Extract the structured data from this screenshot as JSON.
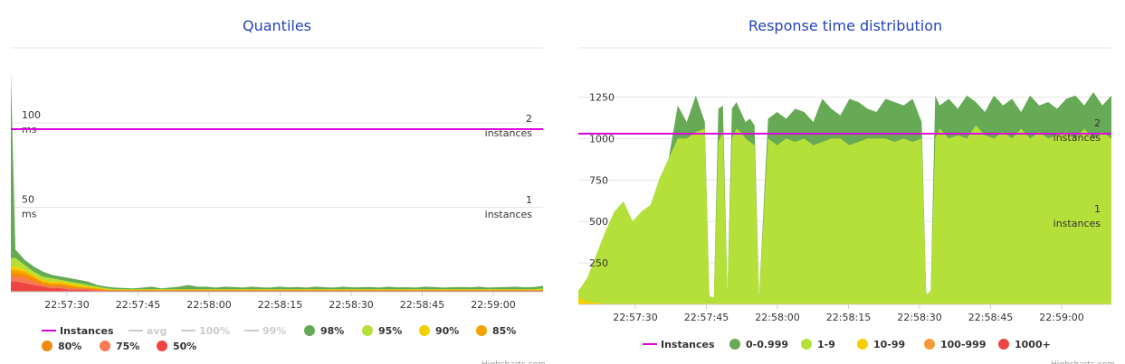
{
  "chart_data": [
    {
      "type": "area",
      "title": "Quantiles",
      "y_left": {
        "ticks": [
          {
            "value": 100,
            "unit": "ms"
          },
          {
            "value": 50,
            "unit": "ms"
          }
        ]
      },
      "y_right": {
        "ticks": [
          {
            "value": 2,
            "unit": "instances"
          },
          {
            "value": 1,
            "unit": "instances"
          }
        ]
      },
      "x_ticks": [
        "22:57:30",
        "22:57:45",
        "22:58:00",
        "22:58:15",
        "22:58:30",
        "22:58:45",
        "22:59:00"
      ],
      "legend": [
        {
          "name": "Instances",
          "color": "#dd00dd",
          "symbol": "line",
          "enabled": true
        },
        {
          "name": "avg",
          "color": "#cccccc",
          "symbol": "line",
          "enabled": false
        },
        {
          "name": "100%",
          "color": "#cccccc",
          "symbol": "line",
          "enabled": false
        },
        {
          "name": "99%",
          "color": "#cccccc",
          "symbol": "line",
          "enabled": false
        },
        {
          "name": "98%",
          "color": "#66aa55",
          "symbol": "dot",
          "enabled": true
        },
        {
          "name": "95%",
          "color": "#b5e03a",
          "symbol": "dot",
          "enabled": true
        },
        {
          "name": "90%",
          "color": "#f5d000",
          "symbol": "dot",
          "enabled": true
        },
        {
          "name": "85%",
          "color": "#f5a300",
          "symbol": "dot",
          "enabled": true
        },
        {
          "name": "80%",
          "color": "#f08a10",
          "symbol": "dot",
          "enabled": true
        },
        {
          "name": "75%",
          "color": "#f87a55",
          "symbol": "dot",
          "enabled": true
        },
        {
          "name": "50%",
          "color": "#ee4444",
          "symbol": "dot",
          "enabled": true
        }
      ],
      "instances_line": 2,
      "series": [
        {
          "name": "50%",
          "color": "#ee4444",
          "x": [
            0,
            1,
            3,
            5,
            7,
            9,
            11,
            13,
            15,
            17,
            19,
            21,
            23,
            25,
            27,
            29,
            31,
            33,
            35,
            37,
            39,
            41,
            43,
            45,
            47,
            49,
            51,
            53,
            55,
            57,
            59,
            61,
            63,
            65,
            67,
            69,
            71,
            73,
            75,
            77,
            79,
            81,
            83,
            85,
            87,
            89,
            91,
            93,
            95,
            97,
            99,
            101,
            103,
            105,
            107,
            109,
            111,
            113,
            115,
            117
          ],
          "y": [
            6,
            6,
            5,
            4,
            3,
            2,
            2,
            1,
            1,
            1,
            0.5,
            0.5,
            0.5,
            0.5,
            0.5,
            0.5,
            0.5,
            0.5,
            0.5,
            0.5,
            0.5,
            0.5,
            0.5,
            0.5,
            0.5,
            0.5,
            0.5,
            0.5,
            0.5,
            0.5,
            0.5,
            0.5,
            0.5,
            0.5,
            0.5,
            0.5,
            0.5,
            0.5,
            0.5,
            0.5,
            0.5,
            0.5,
            0.5,
            0.5,
            0.5,
            0.5,
            0.5,
            0.5,
            0.5,
            0.5,
            0.5,
            0.5,
            0.5,
            0.5,
            0.5,
            0.5,
            0.5,
            0.5,
            0.5,
            0.5
          ]
        },
        {
          "name": "75%",
          "color": "#f87a55",
          "y": [
            9,
            9,
            8,
            6,
            4,
            3,
            3,
            2,
            2,
            1.5,
            1,
            0.8,
            0.6,
            0.6,
            0.6,
            0.6,
            0.6,
            0.6,
            0.6,
            0.6,
            0.6,
            0.6,
            0.6,
            0.6,
            0.6,
            0.6,
            0.6,
            0.6,
            0.6,
            0.6,
            0.6,
            0.6,
            0.6,
            0.6,
            0.6,
            0.6,
            0.6,
            0.6,
            0.6,
            0.6,
            0.6,
            0.6,
            0.6,
            0.6,
            0.6,
            0.6,
            0.6,
            0.6,
            0.6,
            0.6,
            0.6,
            0.6,
            0.6,
            0.6,
            0.6,
            0.6,
            0.6,
            0.6,
            0.6,
            0.6
          ]
        },
        {
          "name": "80%",
          "color": "#f08a10",
          "y": [
            11,
            11,
            10,
            8,
            5,
            4,
            4,
            3,
            2,
            2,
            1.5,
            1,
            0.8,
            0.8,
            0.8,
            0.8,
            0.8,
            0.8,
            0.8,
            0.8,
            0.8,
            0.8,
            0.8,
            0.8,
            0.8,
            0.8,
            0.8,
            0.8,
            0.8,
            0.8,
            0.8,
            0.8,
            0.8,
            0.8,
            0.8,
            0.8,
            0.8,
            0.8,
            0.8,
            0.8,
            0.8,
            0.8,
            0.8,
            0.8,
            0.8,
            0.8,
            0.8,
            0.8,
            0.8,
            0.8,
            0.8,
            0.8,
            0.8,
            0.8,
            0.8,
            0.8,
            0.8,
            0.8,
            0.8,
            0.8
          ]
        },
        {
          "name": "85%",
          "color": "#f5a300",
          "y": [
            13,
            13,
            12,
            9,
            6,
            5,
            5,
            4,
            3,
            2.5,
            2,
            1.2,
            1,
            1,
            1,
            1,
            1,
            1,
            1,
            1,
            1,
            1,
            1,
            1,
            1,
            1,
            1,
            1,
            1,
            1,
            1,
            1,
            1,
            1,
            1,
            1,
            1,
            1,
            1,
            1,
            1,
            1,
            1,
            1,
            1,
            1,
            1,
            1,
            1,
            1,
            1,
            1,
            1,
            1,
            1,
            1,
            1,
            1,
            1,
            1
          ]
        },
        {
          "name": "90%",
          "color": "#f5d000",
          "y": [
            15,
            15,
            13,
            10,
            7,
            6,
            6,
            5,
            4,
            3,
            2.5,
            1.5,
            1.2,
            1.2,
            1.2,
            1.2,
            1.2,
            1.2,
            1.2,
            1.2,
            1.2,
            1.2,
            1.2,
            1.2,
            1.2,
            1.2,
            1.2,
            1.2,
            1.2,
            1.2,
            1.2,
            1.2,
            1.2,
            1.2,
            1.2,
            1.2,
            1.2,
            1.2,
            1.2,
            1.2,
            1.2,
            1.2,
            1.2,
            1.2,
            1.2,
            1.2,
            1.2,
            1.2,
            1.2,
            1.2,
            1.2,
            1.2,
            1.2,
            1.2,
            1.2,
            1.2,
            1.2,
            1.2,
            1.2,
            1.2
          ]
        },
        {
          "name": "95%",
          "color": "#b5e03a",
          "y": [
            20,
            20,
            16,
            12,
            9,
            8,
            7,
            6,
            5,
            4,
            3,
            2,
            1.5,
            1.5,
            1.5,
            1.5,
            1.5,
            1.5,
            1.5,
            1.5,
            1.5,
            1.5,
            1.5,
            1.5,
            1.5,
            1.5,
            1.5,
            1.5,
            1.5,
            1.5,
            1.5,
            1.5,
            1.5,
            1.5,
            1.5,
            1.5,
            1.5,
            1.5,
            1.5,
            1.5,
            1.5,
            1.5,
            1.5,
            1.5,
            1.5,
            1.5,
            1.5,
            1.5,
            1.5,
            1.5,
            1.5,
            1.5,
            1.5,
            1.5,
            1.5,
            1.5,
            1.5,
            1.5,
            1.5,
            2
          ]
        },
        {
          "name": "98%",
          "color": "#66aa55",
          "y": [
            130,
            25,
            19,
            15,
            12,
            10,
            9,
            8,
            7,
            6,
            4,
            3,
            2.5,
            2.2,
            2,
            2.5,
            3,
            2,
            2.5,
            3,
            4,
            3,
            3,
            2.5,
            3,
            2.8,
            2.5,
            3,
            2.6,
            2.5,
            3,
            2.6,
            2.8,
            2.5,
            3,
            2.7,
            2.5,
            3,
            2.6,
            2.7,
            2.8,
            2.5,
            3,
            2.6,
            2.7,
            2.5,
            3,
            2.8,
            2.5,
            2.7,
            2.8,
            2.6,
            3,
            2.5,
            2.7,
            2.8,
            3,
            2.6,
            2.8,
            3.5
          ]
        }
      ]
    },
    {
      "type": "area",
      "title": "Response time distribution",
      "y_left": {
        "ticks": [
          1250,
          1000,
          750,
          500,
          250
        ]
      },
      "y_right": {
        "ticks": [
          {
            "value": 2,
            "unit": "instances"
          },
          {
            "value": 1,
            "unit": "instances"
          }
        ]
      },
      "x_ticks": [
        "22:57:30",
        "22:57:45",
        "22:58:00",
        "22:58:15",
        "22:58:30",
        "22:58:45",
        "22:59:00"
      ],
      "legend": [
        {
          "name": "Instances",
          "color": "#dd00dd",
          "symbol": "line",
          "enabled": true
        },
        {
          "name": "0-0.999",
          "color": "#66aa55",
          "symbol": "dot",
          "enabled": true
        },
        {
          "name": "1-9",
          "color": "#b5e03a",
          "symbol": "dot",
          "enabled": true
        },
        {
          "name": "10-99",
          "color": "#f5d000",
          "symbol": "dot",
          "enabled": true
        },
        {
          "name": "100-999",
          "color": "#f59a3a",
          "symbol": "dot",
          "enabled": true
        },
        {
          "name": "1000+",
          "color": "#ee4444",
          "symbol": "dot",
          "enabled": true
        }
      ],
      "instances_line": 2,
      "series": [
        {
          "name": "10-99",
          "color": "#f5d000",
          "x": [
            0,
            2,
            4,
            6,
            8,
            10,
            12,
            14,
            16,
            18,
            20,
            22,
            24,
            26,
            28,
            29,
            30,
            31,
            32,
            33,
            34,
            35,
            36,
            37,
            38,
            39,
            40,
            42,
            44,
            46,
            48,
            50,
            52,
            54,
            56,
            58,
            60,
            62,
            64,
            66,
            68,
            70,
            72,
            74,
            76,
            77,
            78,
            79,
            80,
            82,
            84,
            86,
            88,
            90,
            92,
            94,
            96,
            98,
            100,
            102,
            104,
            106,
            108,
            110,
            112,
            114,
            116,
            118
          ],
          "y": [
            40,
            20,
            10,
            5,
            5,
            5,
            5,
            5,
            5,
            5,
            5,
            5,
            5,
            5,
            5,
            5,
            5,
            5,
            5,
            5,
            5,
            5,
            5,
            5,
            5,
            5,
            5,
            5,
            5,
            5,
            5,
            5,
            5,
            5,
            5,
            5,
            5,
            5,
            5,
            5,
            5,
            5,
            5,
            5,
            5,
            5,
            5,
            5,
            5,
            5,
            5,
            5,
            5,
            5,
            5,
            5,
            5,
            5,
            5,
            5,
            5,
            5,
            5,
            5,
            5,
            5,
            5,
            5
          ]
        },
        {
          "name": "1-9",
          "color": "#b5e03a",
          "y": [
            80,
            160,
            300,
            440,
            560,
            620,
            500,
            560,
            600,
            760,
            880,
            1000,
            1000,
            1040,
            1060,
            50,
            40,
            980,
            1040,
            60,
            1000,
            1060,
            1040,
            1000,
            980,
            960,
            40,
            1000,
            960,
            1000,
            980,
            1000,
            960,
            980,
            1000,
            1000,
            960,
            980,
            1000,
            1000,
            1000,
            980,
            1000,
            980,
            1000,
            60,
            80,
            1000,
            1060,
            1000,
            1020,
            1000,
            1080,
            1020,
            1000,
            1040,
            1000,
            1060,
            1000,
            1040,
            1000,
            1020,
            1040,
            1000,
            1060,
            1000,
            1040,
            1000
          ]
        },
        {
          "name": "0-0.999",
          "color": "#66aa55",
          "y": [
            80,
            160,
            300,
            440,
            560,
            620,
            500,
            560,
            600,
            760,
            880,
            1200,
            1100,
            1260,
            1100,
            50,
            40,
            1180,
            1200,
            60,
            1180,
            1220,
            1160,
            1100,
            1120,
            1080,
            40,
            1120,
            1160,
            1120,
            1180,
            1160,
            1100,
            1240,
            1180,
            1140,
            1240,
            1220,
            1180,
            1160,
            1240,
            1220,
            1200,
            1240,
            1100,
            60,
            80,
            1260,
            1200,
            1240,
            1180,
            1260,
            1220,
            1160,
            1260,
            1200,
            1240,
            1160,
            1260,
            1200,
            1220,
            1180,
            1240,
            1260,
            1200,
            1280,
            1200,
            1260
          ]
        }
      ]
    }
  ],
  "credit": "Highcharts.com"
}
